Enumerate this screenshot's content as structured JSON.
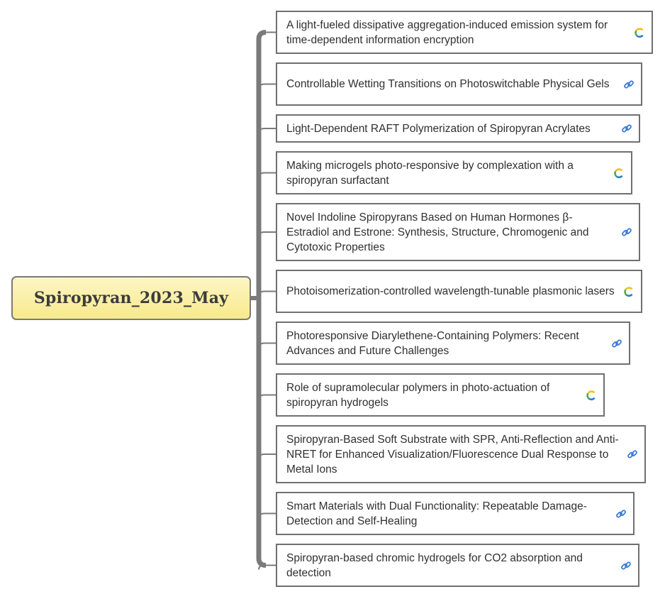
{
  "root": {
    "label": "Spiropyran_2023_May"
  },
  "topics": [
    {
      "title": "A light-fueled dissipative aggregation-induced emission system for time-dependent information encryption",
      "icon": "crossref-icon"
    },
    {
      "title": "Controllable Wetting Transitions on Photoswitchable Physical Gels",
      "icon": "link-icon"
    },
    {
      "title": "Light-Dependent RAFT Polymerization of Spiropyran Acrylates",
      "icon": "link-icon"
    },
    {
      "title": "Making microgels photo-responsive by complexation with a spiropyran surfactant",
      "icon": "crossref-icon"
    },
    {
      "title": "Novel Indoline Spiropyrans Based on Human Hormones β-Estradiol and Estrone: Synthesis, Structure, Chromogenic and Cytotoxic Properties",
      "icon": "link-icon"
    },
    {
      "title": "Photoisomerization-controlled wavelength-tunable plasmonic lasers",
      "icon": "crossref-icon"
    },
    {
      "title": "Photoresponsive Diarylethene-Containing Polymers: Recent Advances and Future Challenges",
      "icon": "link-icon"
    },
    {
      "title": "Role of supramolecular polymers in photo-actuation of spiropyran hydrogels",
      "icon": "crossref-icon"
    },
    {
      "title": "Spiropyran-Based Soft Substrate with SPR, Anti-Reflection and Anti-NRET for Enhanced Visualization/Fluorescence Dual Response to Metal Ions",
      "icon": "link-icon"
    },
    {
      "title": "Smart Materials with Dual Functionality: Repeatable Damage-Detection and Self-Healing",
      "icon": "link-icon"
    },
    {
      "title": "Spiropyran-based chromic hydrogels for CO2 absorption and detection",
      "icon": "link-icon"
    }
  ],
  "colors": {
    "connector": "#7a7a7a",
    "link_icon": "#3a7bd5",
    "crossref_yellow": "#f4c20d",
    "crossref_green": "#3fae49",
    "crossref_blue": "#2e7ac6"
  }
}
